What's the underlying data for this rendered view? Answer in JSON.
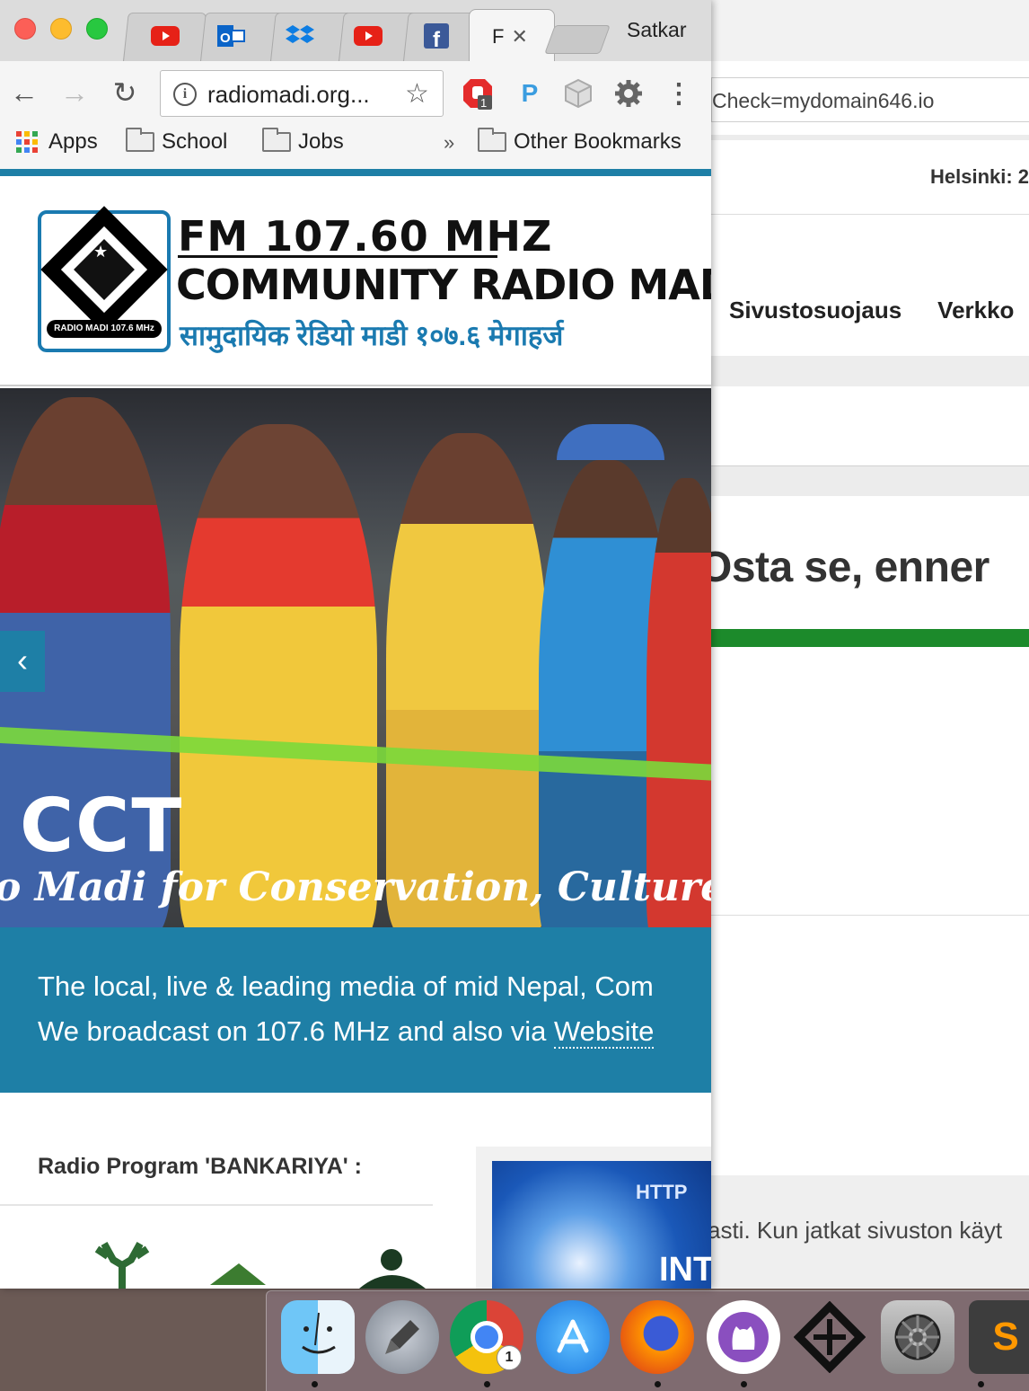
{
  "window": {
    "profile_name": "Satkar",
    "active_tab_label": "F",
    "tabs": [
      {
        "icon": "youtube-icon",
        "color": "#e62117"
      },
      {
        "icon": "outlook-icon",
        "color": "#0a64c8"
      },
      {
        "icon": "dropbox-icon",
        "color": "#0d7de3"
      },
      {
        "icon": "youtube-icon",
        "color": "#e62117"
      },
      {
        "icon": "facebook-icon",
        "color": "#3b5998"
      }
    ]
  },
  "toolbar": {
    "url": "radiomadi.org...",
    "extension_badge": "1",
    "extension_p": "P"
  },
  "bookmarks": {
    "apps": "Apps",
    "items": [
      "School",
      "Jobs"
    ],
    "overflow": "»",
    "other": "Other Bookmarks"
  },
  "site": {
    "brand_line1": "FM 107.60 MHZ",
    "brand_line2": "COMMUNITY RADIO MADI",
    "brand_line3": "सामुदायिक रेडियो माडी १०७.६ मेगाहर्ज",
    "logo_caption": "RADIO MADI 107.6 MHz",
    "slide_title": "CCT",
    "slide_subtitle": "o Madi for Conservation, Culture and T",
    "intro_line1": "The local, live & leading media of mid Nepal, Com",
    "intro_line2_prefix": "We broadcast on 107.6 MHz and also via ",
    "intro_link": "Website",
    "program_heading": "Radio Program 'BANKARIYA' :",
    "sidebar_http": "HTTP",
    "sidebar_int": "INT"
  },
  "background_window": {
    "address_fragment": "Check=mydomain646.io",
    "helsinki": "Helsinki: 2",
    "nav_items": [
      "Sivustosuojaus",
      "Verkko"
    ],
    "heading": "Osta se, enner",
    "cookie_text": "asti. Kun jatkat sivuston käyt"
  },
  "dock": {
    "chrome_badge": "1",
    "apps": [
      "finder-icon",
      "launchpad-icon",
      "chrome-icon",
      "app-store-icon",
      "firefox-icon",
      "github-desktop-icon",
      "unity-icon",
      "system-preferences-icon",
      "sublime-text-icon"
    ]
  },
  "colors": {
    "accent_teal": "#1e7fa6",
    "green_bar": "#1c8a2b"
  }
}
